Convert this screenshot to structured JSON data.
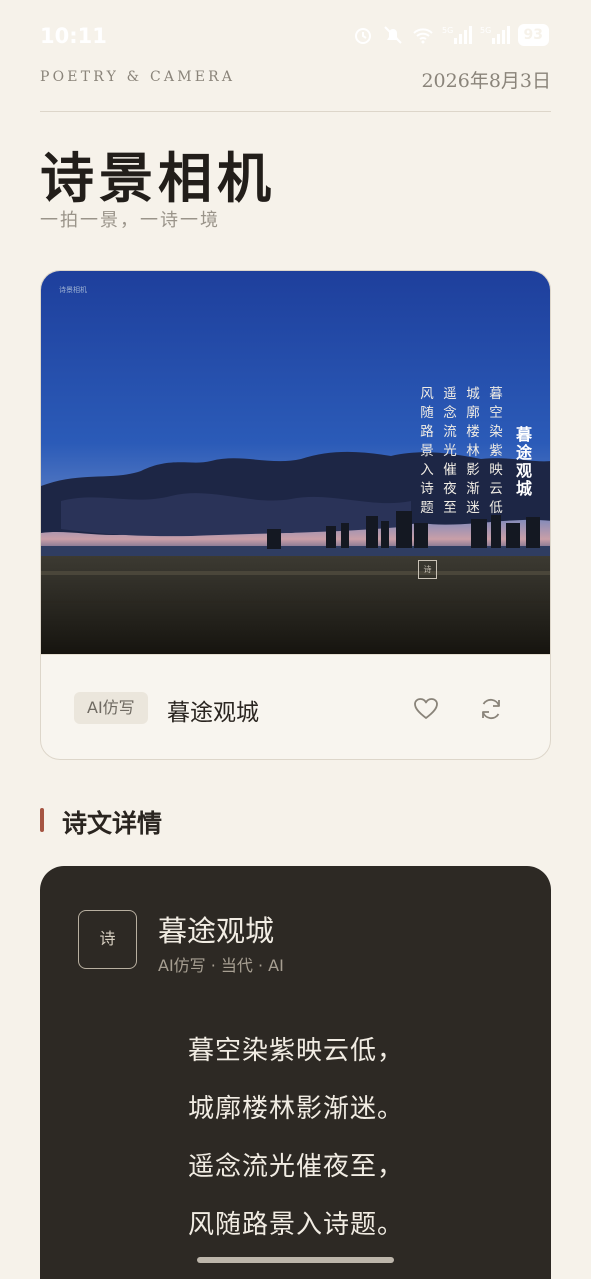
{
  "status_bar": {
    "time": "10:11",
    "battery": "93"
  },
  "header": {
    "brand": "POETRY & CAMERA",
    "date": "2026年8月3日",
    "title": "诗景相机",
    "subtitle": "一拍一景，一诗一境"
  },
  "photo_card": {
    "watermark": "诗景相机",
    "overlay_title": "暮途观城",
    "overlay_lines": [
      "暮空染紫映云低",
      "城廓楼林影渐迷",
      "遥念流光催夜至",
      "风随路景入诗题"
    ],
    "seal": "诗",
    "tag": "AI仿写",
    "poem_title": "暮途观城"
  },
  "section": {
    "title": "诗文详情"
  },
  "detail": {
    "badge": "诗",
    "title": "暮途观城",
    "meta": "AI仿写 · 当代 · AI",
    "lines": [
      "暮空染紫映云低，",
      "城廓楼林影渐迷。",
      "遥念流光催夜至，",
      "风随路景入诗题。"
    ]
  },
  "colors": {
    "background": "#f6f2ea",
    "accent": "#a55542",
    "dark_card": "#2d2924"
  },
  "icons": [
    "alarm-icon",
    "bell-off-icon",
    "wifi-icon",
    "signal-icon",
    "heart-icon",
    "refresh-icon"
  ]
}
